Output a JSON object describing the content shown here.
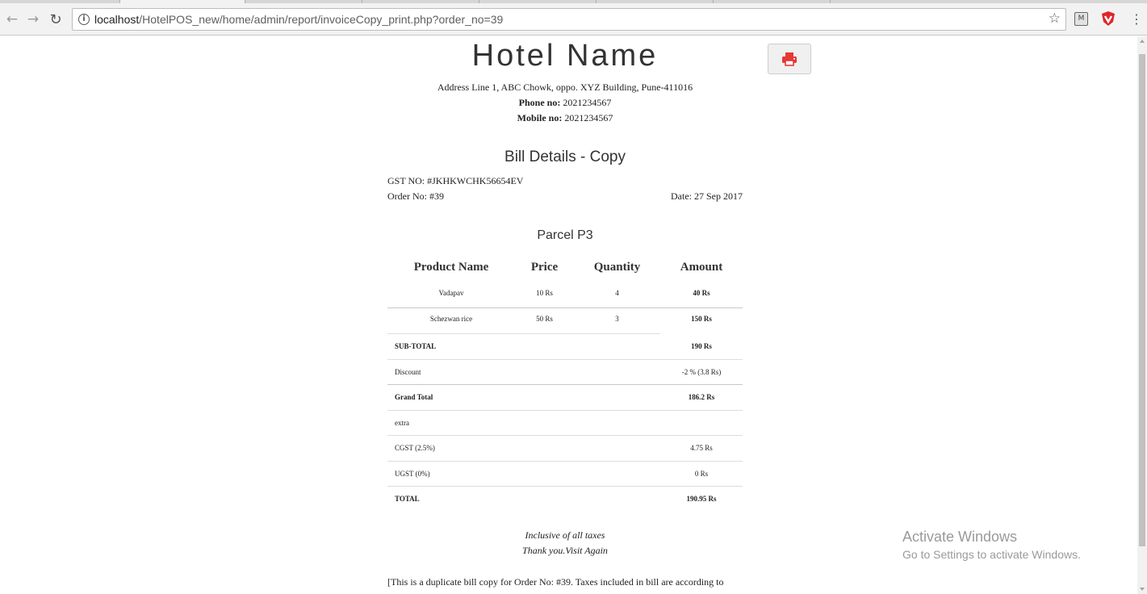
{
  "browser": {
    "url_host": "localhost",
    "url_path": "/HotelPOS_new/home/admin/report/invoiceCopy_print.php?order_no=39"
  },
  "hotel": {
    "name": "Hotel Name",
    "address": "Address Line 1, ABC Chowk, oppo. XYZ Building, Pune-411016",
    "phone_label": "Phone no:",
    "phone": "2021234567",
    "mobile_label": "Mobile no:",
    "mobile": "2021234567"
  },
  "bill": {
    "title": "Bill Details - Copy",
    "gst": "GST NO: #JKHKWCHK56654EV",
    "order_no": "Order No: #39",
    "date": "Date: 27 Sep 2017",
    "table_title": "Parcel P3",
    "columns": [
      "Product Name",
      "Price",
      "Quantity",
      "Amount"
    ],
    "items": [
      {
        "name": "Vadapav",
        "price": "10 Rs",
        "qty": "4",
        "amount": "40 Rs"
      },
      {
        "name": "Schezwan rice",
        "price": "50 Rs",
        "qty": "3",
        "amount": "150 Rs"
      }
    ],
    "summary": [
      {
        "label": "SUB-TOTAL",
        "value": "190 Rs",
        "bold": true
      },
      {
        "label": "Discount",
        "value": "-2 % (3.8 Rs)",
        "bold": false
      },
      {
        "label": "Grand Total",
        "value": "186.2 Rs",
        "bold": true
      },
      {
        "label": "extra",
        "value": "",
        "bold": false
      },
      {
        "label": "CGST (2.5%)",
        "value": "4.75 Rs",
        "bold": false
      },
      {
        "label": "UGST (0%)",
        "value": "0 Rs",
        "bold": false
      },
      {
        "label": "TOTAL",
        "value": "190.95 Rs",
        "bold": true
      }
    ],
    "note1": "Inclusive of all taxes",
    "note2": "Thank you.Visit Again",
    "duplicate_note": "[This is a duplicate bill copy for Order No: #39. Taxes included in bill are according to"
  },
  "watermark": {
    "title": "Activate Windows",
    "subtitle": "Go to Settings to activate Windows."
  },
  "colors": {
    "print_icon": "#e53935"
  }
}
